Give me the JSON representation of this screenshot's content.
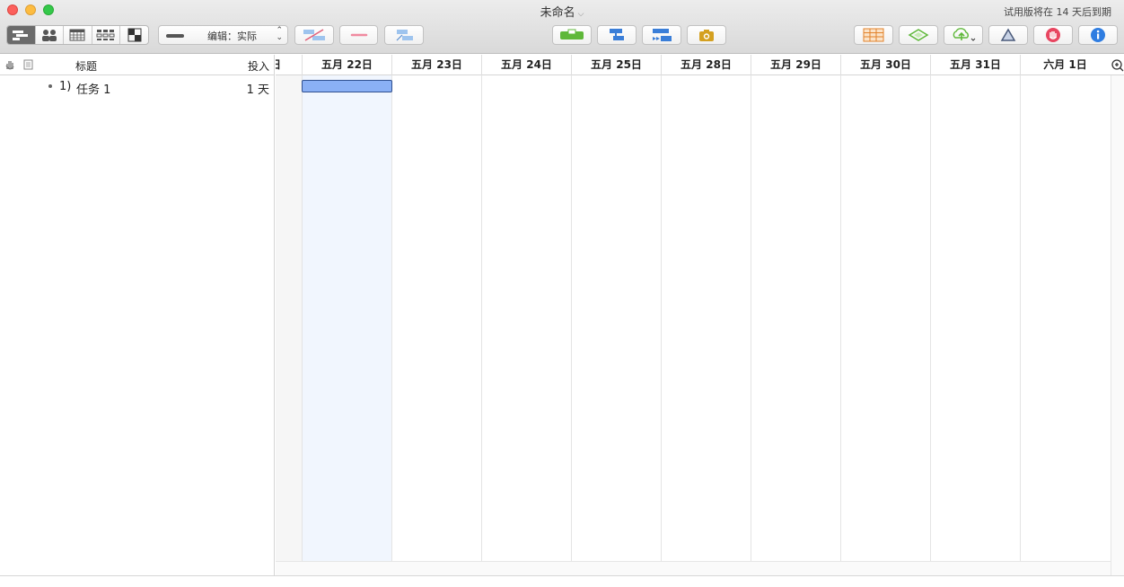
{
  "window": {
    "title": "未命名",
    "trial_notice": "试用版将在 14 天后到期"
  },
  "toolbar": {
    "view_modes": [
      "gantt-view",
      "resource-view",
      "calendar-view",
      "network-view",
      "styles-view"
    ],
    "edit_mode_label": "编辑：实际",
    "buttons": [
      "connect-tasks",
      "disconnect-tasks",
      "schedule-tasks",
      "level-resources",
      "catch-up",
      "baseline",
      "snapshot",
      "export",
      "sync",
      "publish",
      "styles",
      "violations",
      "inspector"
    ]
  },
  "outline": {
    "headers": {
      "title": "标题",
      "effort": "投入"
    },
    "rows": [
      {
        "number": "1)",
        "title": "任务 1",
        "effort": "1 天"
      }
    ]
  },
  "gantt": {
    "partial_first_label": "日",
    "days": [
      "五月 22日",
      "五月 23日",
      "五月 24日",
      "五月 25日",
      "五月 28日",
      "五月 29日",
      "五月 30日",
      "五月 31日",
      "六月 1日"
    ],
    "highlight_day_index": 0,
    "task_bar": {
      "task": "任务 1",
      "start_day_index": 0,
      "duration_days": 1
    }
  },
  "colors": {
    "task_bar_fill": "#8ab0f5",
    "task_bar_border": "#2f4f8f",
    "highlight_column": "#f1f6fe",
    "nonwork_column": "#f6f6f6"
  }
}
